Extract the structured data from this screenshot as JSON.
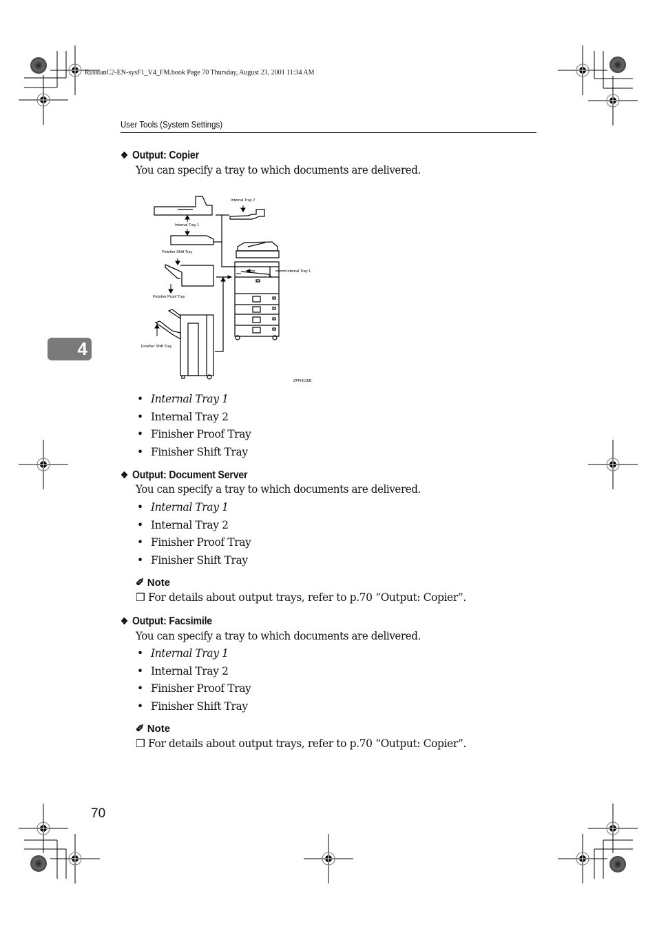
{
  "book_line": "RussianC2-EN-sysF1_V4_FM.book  Page 70  Thursday, August 23, 2001  11:34 AM",
  "running_head": "User Tools (System Settings)",
  "chapter_tab": "4",
  "page_number": "70",
  "sections": [
    {
      "title": "Output: Copier",
      "description": "You can specify a tray to which documents are delivered.",
      "items": [
        "Internal Tray 1",
        "Internal Tray 2",
        "Finisher Proof Tray",
        "Finisher Shift Tray"
      ],
      "default_item": "Internal Tray 1"
    },
    {
      "title": "Output: Document Server",
      "description": "You can specify a tray to which documents are delivered.",
      "items": [
        "Internal Tray 1",
        "Internal Tray 2",
        "Finisher Proof Tray",
        "Finisher Shift Tray"
      ],
      "default_item": "Internal Tray 1",
      "note": {
        "title": "Note",
        "text": "For details about output trays, refer to p.70 “Output: Copier”."
      }
    },
    {
      "title": "Output: Facsimile",
      "description": "You can specify a tray to which documents are delivered.",
      "items": [
        "Internal Tray 1",
        "Internal Tray 2",
        "Finisher Proof Tray",
        "Finisher Shift Tray"
      ],
      "default_item": "Internal Tray 1",
      "note": {
        "title": "Note",
        "text": "For details about output trays, refer to p.70 “Output: Copier”."
      }
    }
  ],
  "diagram": {
    "labels": {
      "internal_tray_2": "Internal Tray 2",
      "internal_tray_1_left": "Internal Tray 1",
      "finisher_shift_tray_top": "Finisher Shift Tray",
      "internal_tray_1_right": "Internal Tray 1",
      "finisher_proof_tray": "Finisher Proof Tray",
      "finisher_shift_tray_bottom": "Finisher Shift Tray",
      "figure_code": "ZFFH110E"
    }
  },
  "icons": {
    "section_bullet": "diamond-cluster-icon",
    "note": "pencil-icon",
    "note_item": "checkbox-icon"
  }
}
